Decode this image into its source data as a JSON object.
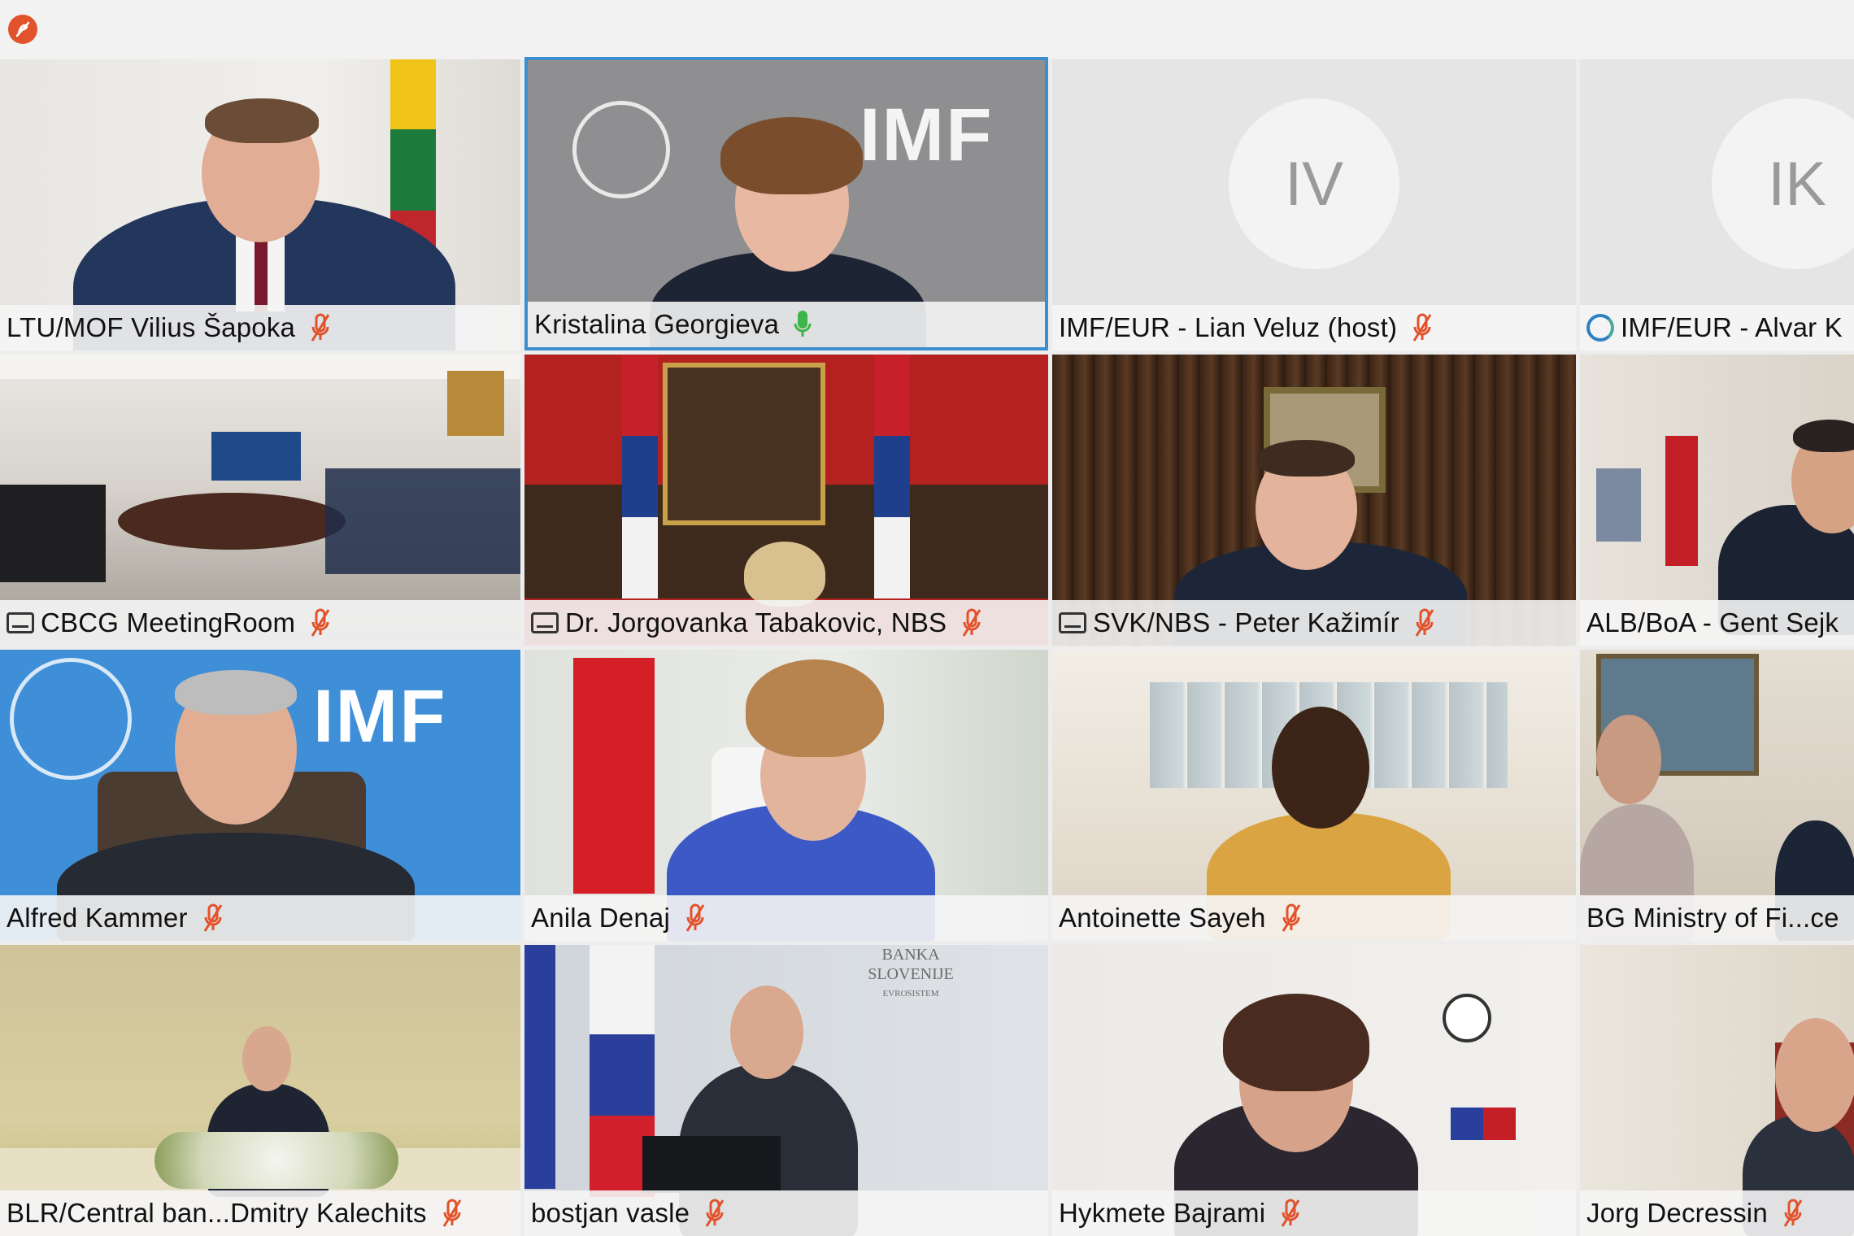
{
  "app": {
    "badge_icon": "logo-icon",
    "accent_color": "#e2522b",
    "active_speaker_border": "#3b8fcf",
    "mic_on_color": "#3db54a",
    "mic_off_color": "#e2522b"
  },
  "participants": [
    {
      "name": "LTU/MOF Vilius Šapoka",
      "mic": "muted",
      "prefix_icon": ""
    },
    {
      "name": "Kristalina Georgieva",
      "mic": "active",
      "prefix_icon": "",
      "active": true
    },
    {
      "name": "IMF/EUR - Lian Veluz (host)",
      "mic": "muted",
      "prefix_icon": "",
      "initials": "IV"
    },
    {
      "name": "IMF/EUR - Alvar K",
      "mic": "",
      "prefix_icon": "globe-icon",
      "initials": "IK"
    },
    {
      "name": "CBCG MeetingRoom",
      "mic": "muted",
      "prefix_icon": "room-icon"
    },
    {
      "name": "Dr. Jorgovanka Tabakovic, NBS",
      "mic": "muted",
      "prefix_icon": "room-icon"
    },
    {
      "name": "SVK/NBS - Peter Kažimír",
      "mic": "muted",
      "prefix_icon": "room-icon"
    },
    {
      "name": "ALB/BoA - Gent Sejk",
      "mic": "",
      "prefix_icon": ""
    },
    {
      "name": "Alfred Kammer",
      "mic": "muted",
      "prefix_icon": ""
    },
    {
      "name": "Anila Denaj",
      "mic": "muted",
      "prefix_icon": ""
    },
    {
      "name": "Antoinette Sayeh",
      "mic": "muted",
      "prefix_icon": ""
    },
    {
      "name": "BG Ministry of Fi...ce",
      "mic": "",
      "prefix_icon": ""
    },
    {
      "name": "BLR/Central ban...Dmitry Kalechits",
      "mic": "muted",
      "prefix_icon": ""
    },
    {
      "name": "bostjan vasle",
      "mic": "muted",
      "prefix_icon": ""
    },
    {
      "name": "Hykmete Bajrami",
      "mic": "muted",
      "prefix_icon": ""
    },
    {
      "name": "Jorg Decressin",
      "mic": "muted",
      "prefix_icon": ""
    }
  ],
  "backgrounds": {
    "imf_label": "IMF",
    "banka_label_1": "BANKA",
    "banka_label_2": "SLOVENIJE",
    "banka_label_3": "EVROSISTEM"
  }
}
